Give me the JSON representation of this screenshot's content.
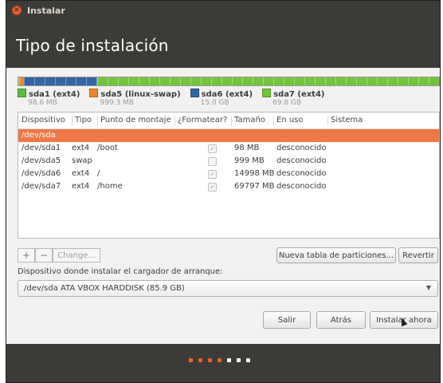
{
  "window": {
    "title": "Instalar",
    "close_glyph": "×"
  },
  "header": {
    "title": "Tipo de instalación"
  },
  "partition_bar": {
    "segments": [
      {
        "name": "sda1",
        "share": 0.0011,
        "color": "#5fb844"
      },
      {
        "name": "sda5",
        "share": 0.0116,
        "color": "#e9882d"
      },
      {
        "name": "sda6",
        "share": 0.175,
        "color": "#3465a4"
      },
      {
        "name": "sda7",
        "share": 0.8123,
        "color": "#73c23c"
      }
    ]
  },
  "legend": [
    {
      "label": "sda1 (ext4)",
      "size": "98.6 MB",
      "color": "#5fb844"
    },
    {
      "label": "sda5 (linux-swap)",
      "size": "999.3 MB",
      "color": "#e9882d"
    },
    {
      "label": "sda6 (ext4)",
      "size": "15.0 GB",
      "color": "#3465a4"
    },
    {
      "label": "sda7 (ext4)",
      "size": "69.8 GB",
      "color": "#73c23c"
    }
  ],
  "table": {
    "columns": [
      "Dispositivo",
      "Tipo",
      "Punto de montaje",
      "¿Formatear?",
      "Tamaño",
      "En uso",
      "Sistema"
    ],
    "selected_row": "/dev/sda",
    "rows": [
      {
        "device": "/dev/sda1",
        "type": "ext4",
        "mount": "/boot",
        "format": true,
        "size": "98 MB",
        "used": "desconocido",
        "system": ""
      },
      {
        "device": "/dev/sda5",
        "type": "swap",
        "mount": "",
        "format": false,
        "size": "999 MB",
        "used": "desconocido",
        "system": ""
      },
      {
        "device": "/dev/sda6",
        "type": "ext4",
        "mount": "/",
        "format": true,
        "size": "14998 MB",
        "used": "desconocido",
        "system": ""
      },
      {
        "device": "/dev/sda7",
        "type": "ext4",
        "mount": "/home",
        "format": true,
        "size": "69797 MB",
        "used": "desconocido",
        "system": ""
      }
    ]
  },
  "toolbar": {
    "add": "+",
    "remove": "−",
    "change": "Change...",
    "new_table": "Nueva tabla de particiones...",
    "revert": "Revertir"
  },
  "bootloader": {
    "label": "Dispositivo donde instalar el cargador de arranque:",
    "value": "/dev/sda   ATA VBOX HARDDISK (85.9 GB)",
    "arrow": "▼"
  },
  "actions": {
    "quit": "Salir",
    "back": "Atrás",
    "install": "Instalar ahora"
  },
  "progress_dots": {
    "total": 7,
    "completed": 4,
    "done_color": "#e9602a",
    "pending_color": "#ffffff"
  },
  "icons": {
    "close": "close-icon",
    "checkbox": "checkbox-icon",
    "cursor": "cursor-icon",
    "dropdown": "chevron-down-icon"
  }
}
